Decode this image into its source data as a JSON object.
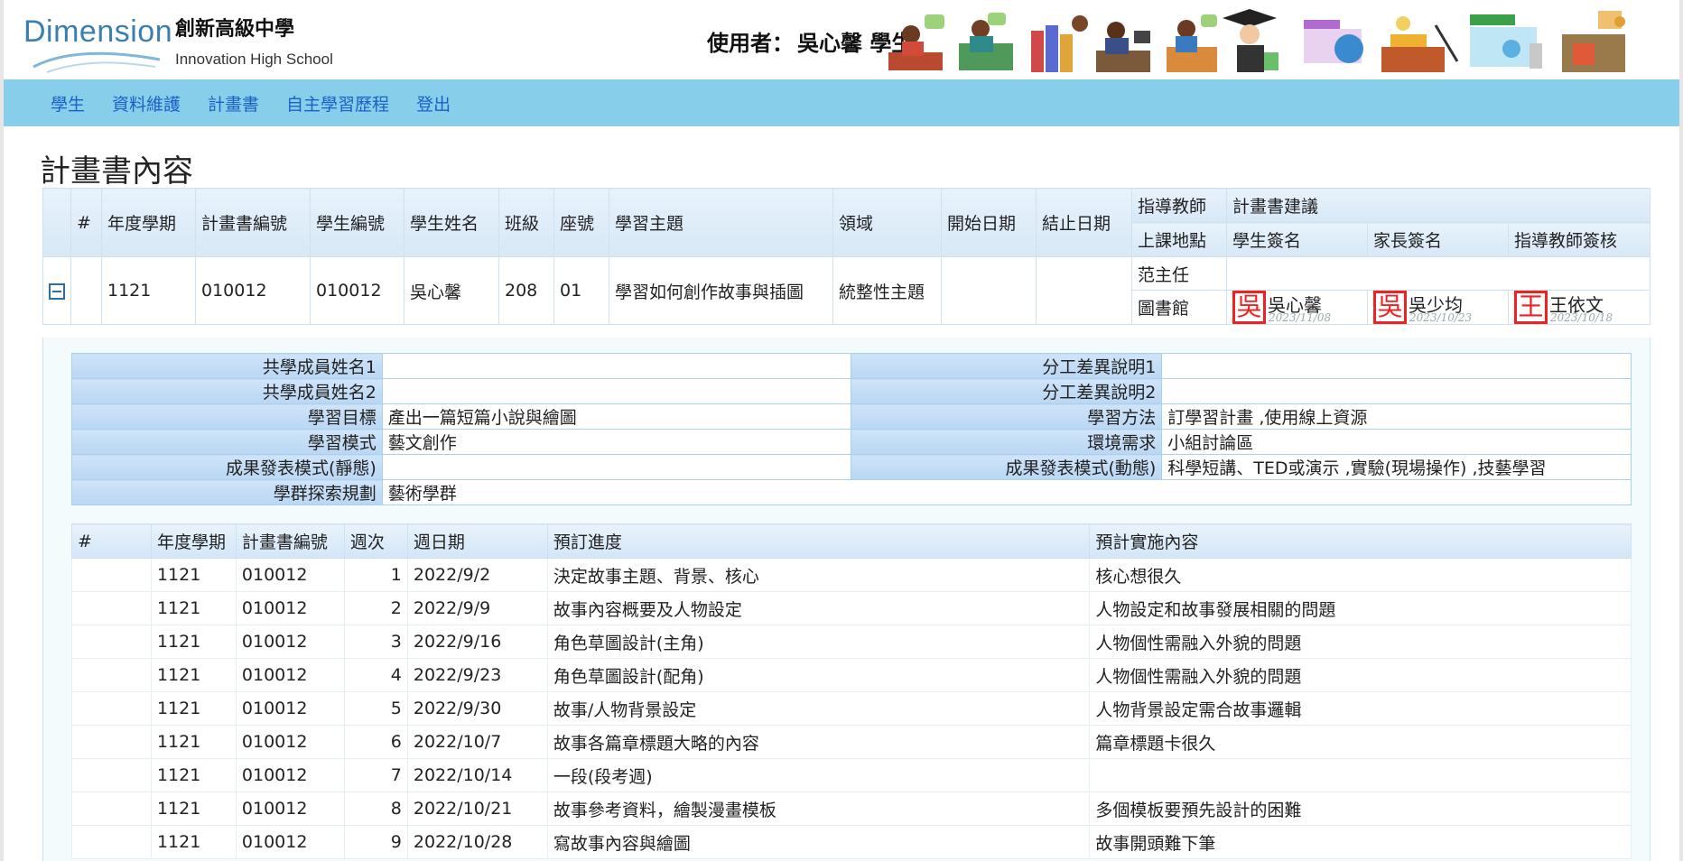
{
  "header": {
    "logo_text": "Dimension",
    "school_cn": "創新高級中學",
    "school_en": "Innovation High School",
    "user_label": "使用者：",
    "user_name": "吳心馨 學生"
  },
  "nav": {
    "items": [
      "學生",
      "資料維護",
      "計畫書",
      "自主學習歷程",
      "登出"
    ]
  },
  "page_title": "計畫書內容",
  "main_table": {
    "headers": {
      "num": "#",
      "term": "年度學期",
      "plan_id": "計畫書編號",
      "student_id": "學生編號",
      "student_name": "學生姓名",
      "class": "班級",
      "seat": "座號",
      "topic": "學習主題",
      "domain": "領域",
      "start": "開始日期",
      "end": "結止日期",
      "advisor": "指導教師",
      "suggestion": "計畫書建議",
      "location": "上課地點",
      "student_sign": "學生簽名",
      "parent_sign": "家長簽名",
      "teacher_sign": "指導教師簽核"
    },
    "row": {
      "term": "1121",
      "plan_id": "010012",
      "student_id": "010012",
      "student_name": "吳心馨",
      "class": "208",
      "seat": "01",
      "topic": "學習如何創作故事與插圖",
      "domain": "統整性主題",
      "start": "",
      "end": "",
      "advisor": "范主任",
      "suggestion": "",
      "location": "圖書館",
      "student_sign": {
        "seal": "吳",
        "name": "吳心馨",
        "date": "2023/11/08"
      },
      "parent_sign": {
        "seal": "吳",
        "name": "吳少均",
        "date": "2023/10/23"
      },
      "teacher_sign": {
        "seal": "王",
        "name": "王依文",
        "date": "2023/10/18"
      }
    }
  },
  "info": {
    "labels": {
      "co_member1": "共學成員姓名1",
      "co_member2": "共學成員姓名2",
      "goal": "學習目標",
      "mode": "學習模式",
      "present_static": "成果發表模式(靜態)",
      "career": "學群探索規劃",
      "diff1": "分工差異說明1",
      "diff2": "分工差異說明2",
      "method": "學習方法",
      "env": "環境需求",
      "present_dynamic": "成果發表模式(動態)"
    },
    "values": {
      "co_member1": "",
      "co_member2": "",
      "goal": "產出一篇短篇小說與繪圖",
      "mode": "藝文創作",
      "present_static": "",
      "career": "藝術學群",
      "diff1": "",
      "diff2": "",
      "method": "訂學習計畫 ,使用線上資源",
      "env": "小組討論區",
      "present_dynamic": "科學短講、TED或演示 ,實驗(現場操作) ,技藝學習"
    }
  },
  "plan": {
    "headers": [
      "#",
      "年度學期",
      "計畫書編號",
      "週次",
      "週日期",
      "預訂進度",
      "預計實施內容"
    ],
    "rows": [
      {
        "term": "1121",
        "id": "010012",
        "week": "1",
        "date": "2022/9/2",
        "progress": "決定故事主題、背景、核心",
        "content": "核心想很久"
      },
      {
        "term": "1121",
        "id": "010012",
        "week": "2",
        "date": "2022/9/9",
        "progress": "故事內容概要及人物設定",
        "content": "人物設定和故事發展相關的問題"
      },
      {
        "term": "1121",
        "id": "010012",
        "week": "3",
        "date": "2022/9/16",
        "progress": "角色草圖設計(主角)",
        "content": "人物個性需融入外貌的問題"
      },
      {
        "term": "1121",
        "id": "010012",
        "week": "4",
        "date": "2022/9/23",
        "progress": "角色草圖設計(配角)",
        "content": "人物個性需融入外貌的問題"
      },
      {
        "term": "1121",
        "id": "010012",
        "week": "5",
        "date": "2022/9/30",
        "progress": "故事/人物背景設定",
        "content": "人物背景設定需合故事邏輯"
      },
      {
        "term": "1121",
        "id": "010012",
        "week": "6",
        "date": "2022/10/7",
        "progress": "故事各篇章標題大略的內容",
        "content": "篇章標題卡很久"
      },
      {
        "term": "1121",
        "id": "010012",
        "week": "7",
        "date": "2022/10/14",
        "progress": "一段(段考週)",
        "content": ""
      },
      {
        "term": "1121",
        "id": "010012",
        "week": "8",
        "date": "2022/10/21",
        "progress": "故事參考資料，繪製漫畫模板",
        "content": "多個模板要預先設計的困難"
      },
      {
        "term": "1121",
        "id": "010012",
        "week": "9",
        "date": "2022/10/28",
        "progress": "寫故事內容與繪圖",
        "content": "故事開頭難下筆"
      }
    ]
  }
}
